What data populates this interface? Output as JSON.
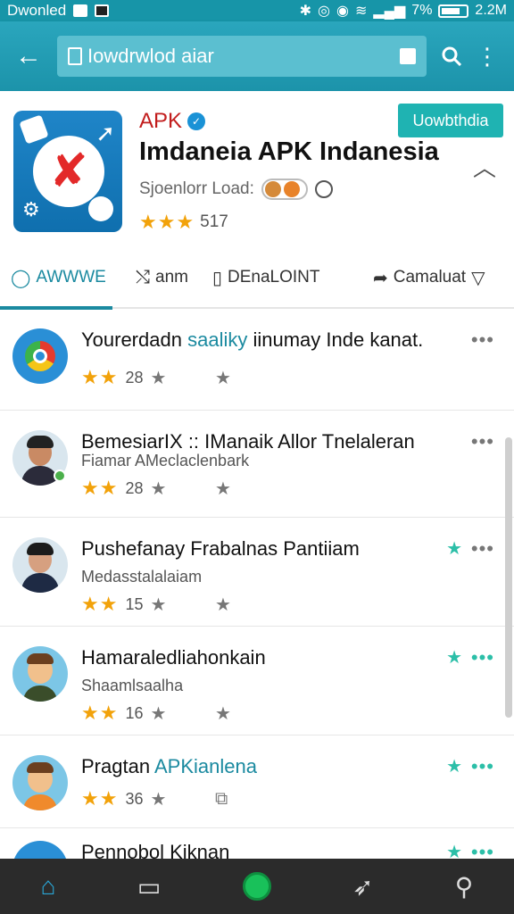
{
  "status_bar": {
    "left_text": "Dwonled",
    "battery": "7%",
    "time": "2.2M"
  },
  "app_bar": {
    "search_text": "Iowdrwlod aiar",
    "back_icon": "arrow-left-icon",
    "search_icon": "magnifier-icon",
    "menu_icon": "vertical-dots-icon"
  },
  "app": {
    "name": "APK",
    "title": "Imdaneia APK Indanesia",
    "subtitle": "Sjoenlorr Load:",
    "rating_value": "517",
    "install_label": "Uowbthdia"
  },
  "tabs": [
    {
      "label": "AWWWE",
      "icon": "chat-icon"
    },
    {
      "label": "anm",
      "icon": "shuffle-icon"
    },
    {
      "label": "DEnaLOINT",
      "icon": "bookmark-icon"
    },
    {
      "label": "Camaluat",
      "icon": "share-icon"
    }
  ],
  "items": [
    {
      "title": "Yourerdadn",
      "title_accent": "saaliky",
      "title_rest": "iinumay Inde kanat.",
      "subtitle": "",
      "rating": "28"
    },
    {
      "title": "BemesiarIX :: IManaik Allor Tnelaleran",
      "title_accent": "",
      "title_rest": "",
      "subtitle": "Fiamar AMeclaclenbark",
      "rating": "28"
    },
    {
      "title": "Pushefanay Frabalnas Pantiiam",
      "title_accent": "",
      "title_rest": "",
      "subtitle": "Medasstalalaiam",
      "rating": "15"
    },
    {
      "title": "Hamaraledliahonkain",
      "title_accent": "",
      "title_rest": "",
      "subtitle": "Shaamlsaalha",
      "rating": "16"
    },
    {
      "title": "Pragtan",
      "title_accent": "APKianlena",
      "title_rest": "",
      "subtitle": "",
      "rating": "36"
    },
    {
      "title": "Pennobol Kiknan",
      "title_accent": "",
      "title_rest": "",
      "subtitle": "",
      "rating": ""
    }
  ],
  "colors": {
    "accent": "#1b8aa0",
    "app_bar": "#1f9ab0",
    "install": "#1fb3b2",
    "star": "#f2a20a",
    "favorite": "#2cbfa8"
  }
}
